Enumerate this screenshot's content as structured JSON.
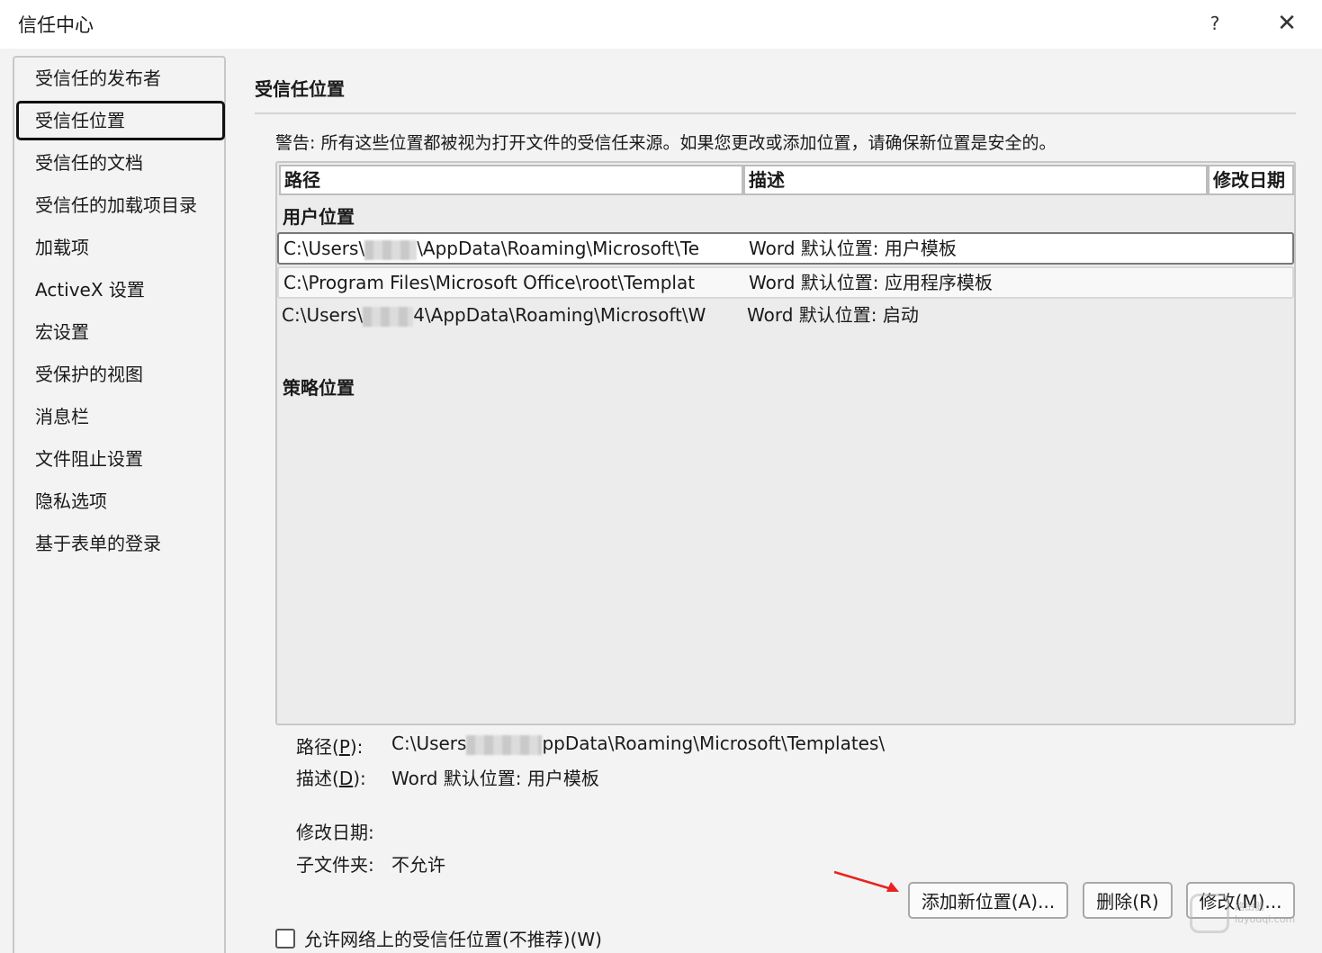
{
  "window": {
    "title": "信任中心",
    "help_label": "?",
    "close_label": "✕"
  },
  "sidebar": {
    "items": [
      {
        "label": "受信任的发布者"
      },
      {
        "label": "受信任位置",
        "selected": true
      },
      {
        "label": "受信任的文档"
      },
      {
        "label": "受信任的加载项目录"
      },
      {
        "label": "加载项"
      },
      {
        "label": "ActiveX 设置"
      },
      {
        "label": "宏设置"
      },
      {
        "label": "受保护的视图"
      },
      {
        "label": "消息栏"
      },
      {
        "label": "文件阻止设置"
      },
      {
        "label": "隐私选项"
      },
      {
        "label": "基于表单的登录"
      }
    ]
  },
  "main": {
    "title": "受信任位置",
    "warning": "警告: 所有这些位置都被视为打开文件的受信任来源。如果您更改或添加位置，请确保新位置是安全的。",
    "columns": {
      "path": "路径",
      "description": "描述",
      "modified": "修改日期"
    },
    "user_group_label": "用户位置",
    "policy_group_label": "策略位置",
    "rows": [
      {
        "path_prefix": "C:\\Users\\",
        "path_suffix": "\\AppData\\Roaming\\Microsoft\\Te",
        "description": "Word 默认位置: 用户模板"
      },
      {
        "path_prefix": "C:\\Program Files\\Microsoft Office\\root\\Templat",
        "path_suffix": "",
        "description": "Word 默认位置: 应用程序模板"
      },
      {
        "path_prefix": "C:\\Users\\",
        "path_suffix": "4\\AppData\\Roaming\\Microsoft\\W",
        "description": "Word 默认位置: 启动"
      }
    ]
  },
  "details": {
    "path_label": "路径(",
    "path_key": "P",
    "path_label_end": "):",
    "path_prefix": "C:\\Users",
    "path_suffix": "ppData\\Roaming\\Microsoft\\Templates\\",
    "desc_label": "描述(",
    "desc_key": "D",
    "desc_label_end": "):",
    "desc_value": "Word 默认位置: 用户模板",
    "modified_label": "修改日期:",
    "modified_value": "",
    "subfolders_label": "子文件夹:",
    "subfolders_value": "不允许"
  },
  "buttons": {
    "add": "添加新位置(A)...",
    "remove": "删除(R)",
    "modify": "修改(M)..."
  },
  "checkbox": {
    "label": "允许网络上的受信任位置(不推荐)(W)",
    "checked": false
  },
  "watermark": {
    "line1": "路由器",
    "line2": "luyouqi.com"
  },
  "colors": {
    "arrow": "#e8231f",
    "selected_border": "#111111"
  }
}
